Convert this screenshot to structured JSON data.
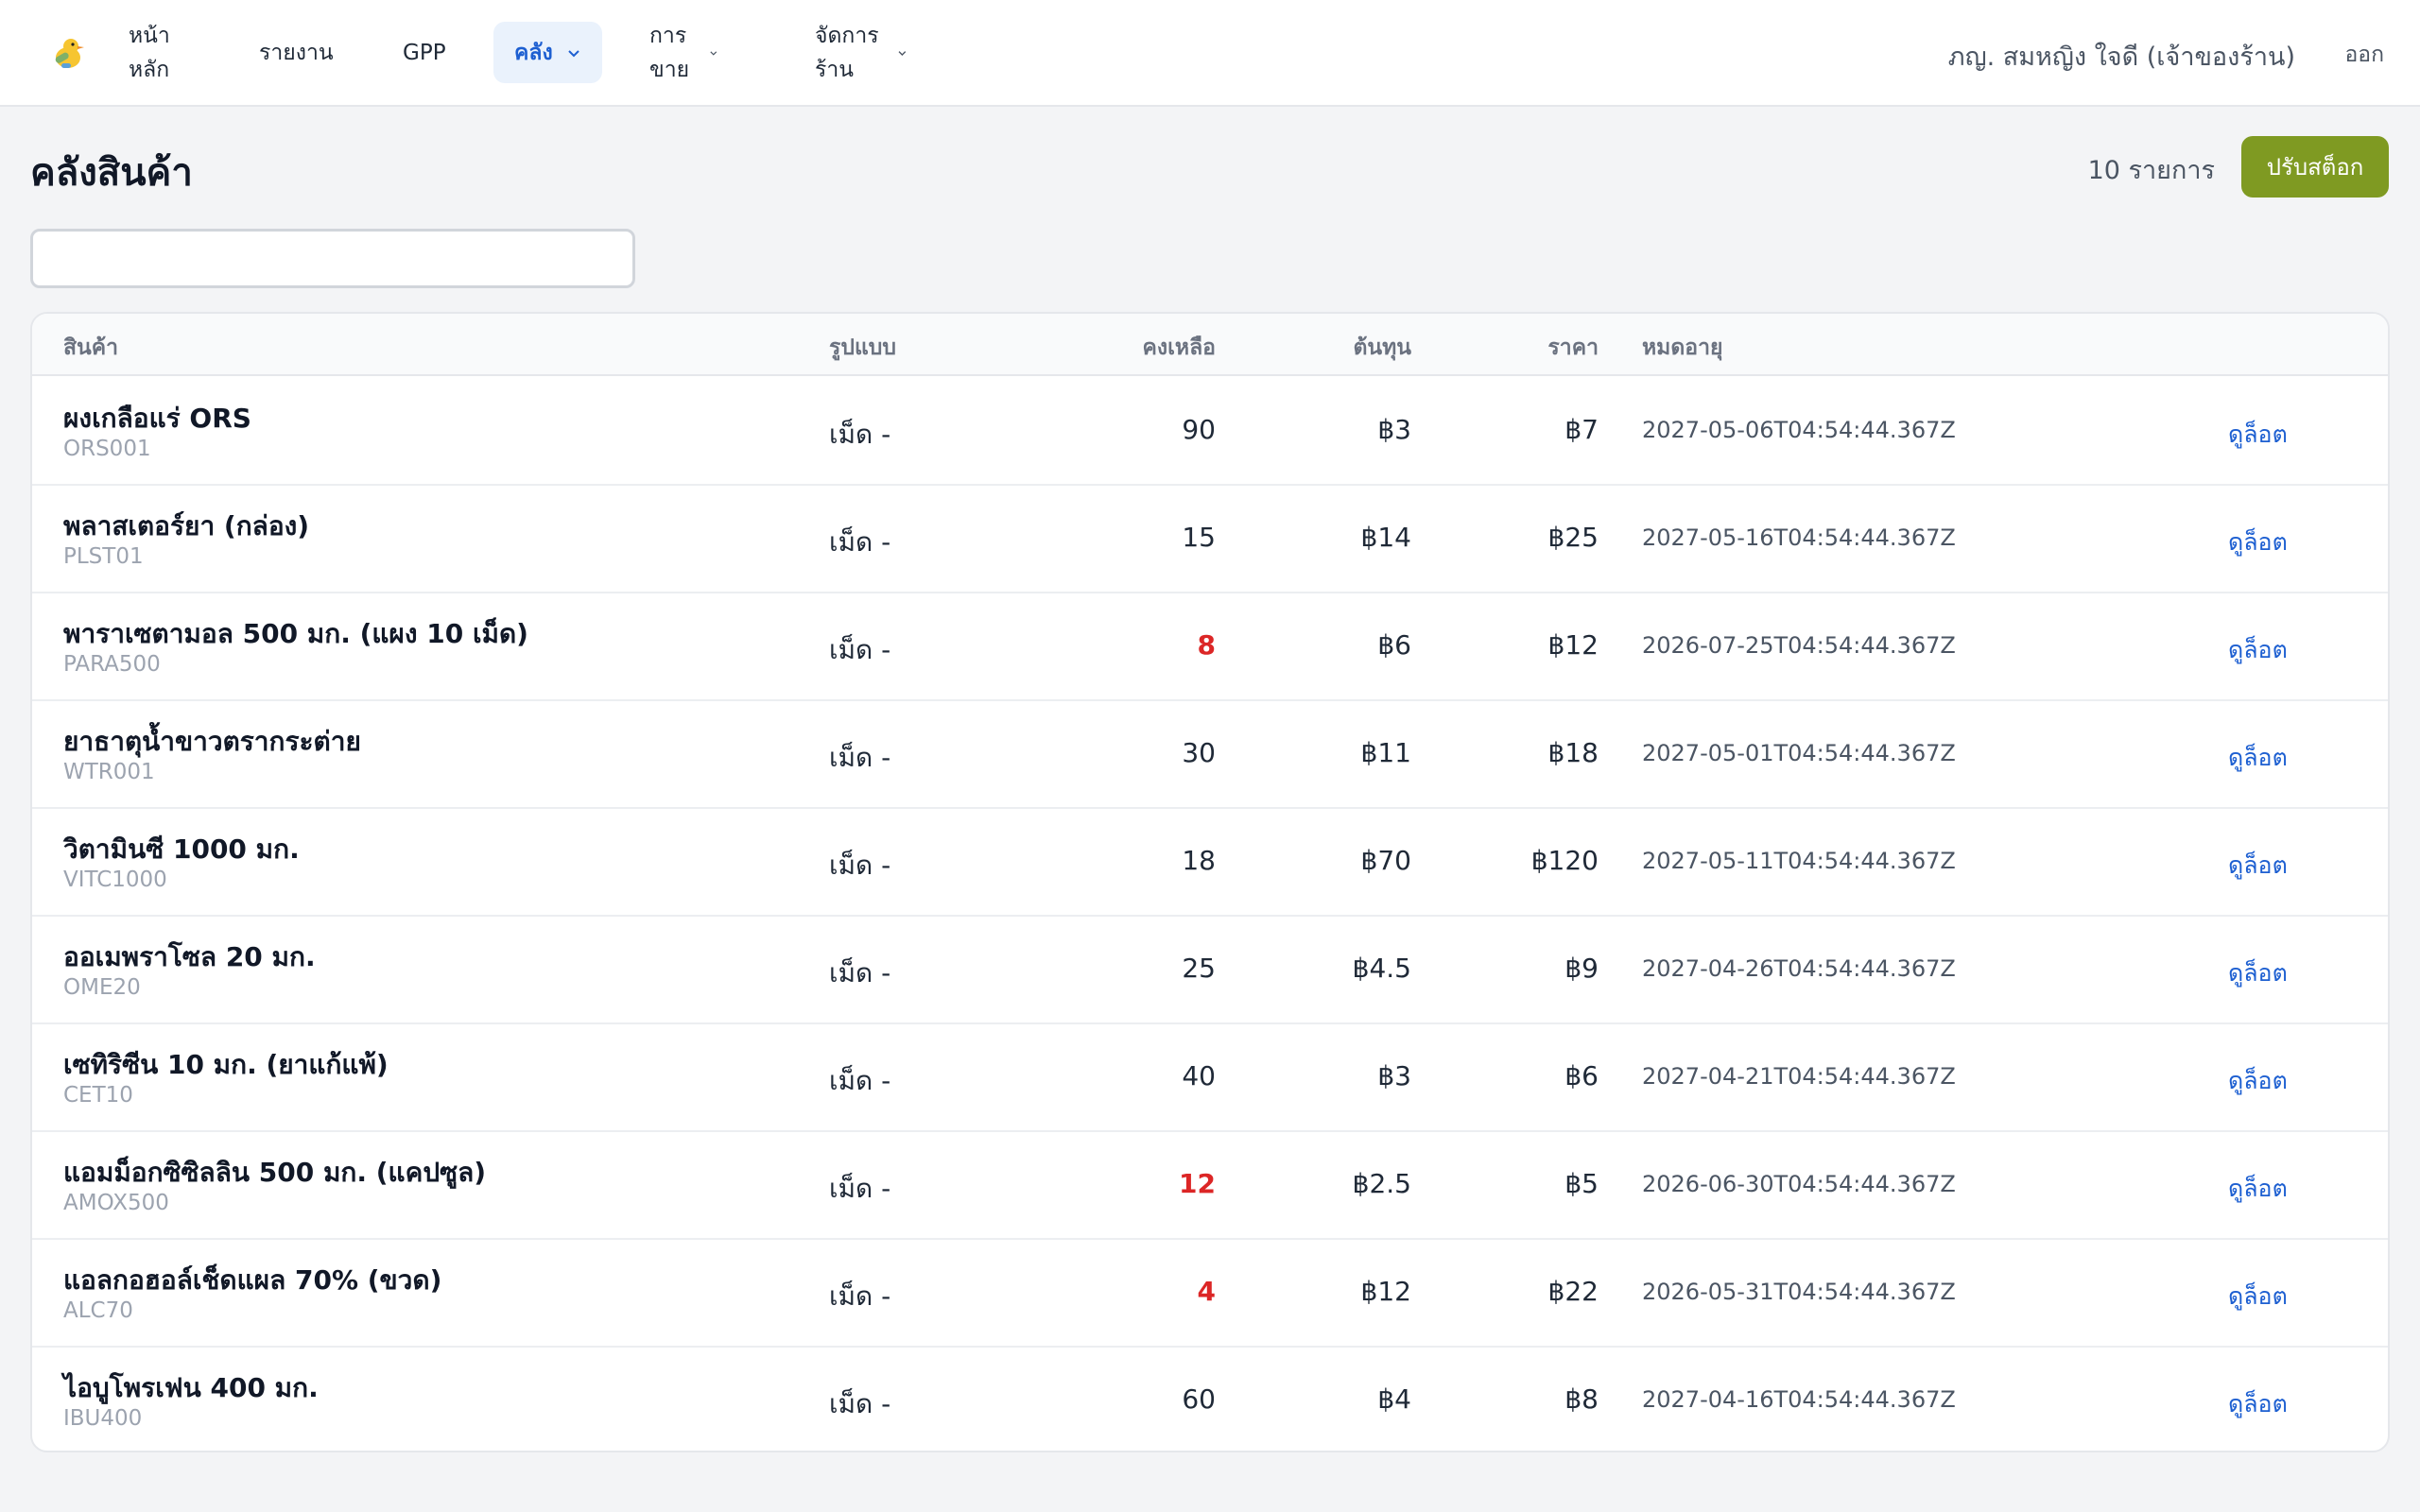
{
  "nav": {
    "logo_icon": "chick-pill-icon",
    "items": [
      {
        "label": "หน้าหลัก",
        "has_dropdown": false,
        "active": false
      },
      {
        "label": "รายงาน",
        "has_dropdown": false,
        "active": false
      },
      {
        "label": "GPP",
        "has_dropdown": false,
        "active": false
      },
      {
        "label": "คลัง",
        "has_dropdown": true,
        "active": true
      },
      {
        "label": "การขาย",
        "has_dropdown": true,
        "active": false
      },
      {
        "label": "จัดการร้าน",
        "has_dropdown": true,
        "active": false
      }
    ],
    "user": "ภญ. สมหญิง ใจดี (เจ้าของร้าน)",
    "logout": "ออก"
  },
  "page": {
    "title": "คลังสินค้า",
    "count": "10 รายการ",
    "adjust_label": "ปรับสต็อก",
    "search_value": "",
    "search_placeholder": ""
  },
  "table": {
    "headers": {
      "product": "สินค้า",
      "form": "รูปแบบ",
      "remaining": "คงเหลือ",
      "cost": "ต้นทุน",
      "price": "ราคา",
      "expiry": "หมดอายุ"
    },
    "rows": [
      {
        "name": "ผงเกลือแร่ ORS",
        "code": "ORS001",
        "form": "เม็ด -",
        "remaining": "90",
        "low": false,
        "cost": "฿3",
        "price": "฿7",
        "expiry": "2027-05-06T04:54:44.367Z",
        "action": "ดูล็อต"
      },
      {
        "name": "พลาสเตอร์ยา (กล่อง)",
        "code": "PLST01",
        "form": "เม็ด -",
        "remaining": "15",
        "low": false,
        "cost": "฿14",
        "price": "฿25",
        "expiry": "2027-05-16T04:54:44.367Z",
        "action": "ดูล็อต"
      },
      {
        "name": "พาราเซตามอล 500 มก. (แผง 10 เม็ด)",
        "code": "PARA500",
        "form": "เม็ด -",
        "remaining": "8",
        "low": true,
        "cost": "฿6",
        "price": "฿12",
        "expiry": "2026-07-25T04:54:44.367Z",
        "action": "ดูล็อต"
      },
      {
        "name": "ยาธาตุน้ำขาวตรากระต่าย",
        "code": "WTR001",
        "form": "เม็ด -",
        "remaining": "30",
        "low": false,
        "cost": "฿11",
        "price": "฿18",
        "expiry": "2027-05-01T04:54:44.367Z",
        "action": "ดูล็อต"
      },
      {
        "name": "วิตามินซี 1000 มก.",
        "code": "VITC1000",
        "form": "เม็ด -",
        "remaining": "18",
        "low": false,
        "cost": "฿70",
        "price": "฿120",
        "expiry": "2027-05-11T04:54:44.367Z",
        "action": "ดูล็อต"
      },
      {
        "name": "ออเมพราโซล 20 มก.",
        "code": "OME20",
        "form": "เม็ด -",
        "remaining": "25",
        "low": false,
        "cost": "฿4.5",
        "price": "฿9",
        "expiry": "2027-04-26T04:54:44.367Z",
        "action": "ดูล็อต"
      },
      {
        "name": "เซทิริซีน 10 มก. (ยาแก้แพ้)",
        "code": "CET10",
        "form": "เม็ด -",
        "remaining": "40",
        "low": false,
        "cost": "฿3",
        "price": "฿6",
        "expiry": "2027-04-21T04:54:44.367Z",
        "action": "ดูล็อต"
      },
      {
        "name": "แอมม็อกซิซิลลิน 500 มก. (แคปซูล)",
        "code": "AMOX500",
        "form": "เม็ด -",
        "remaining": "12",
        "low": true,
        "cost": "฿2.5",
        "price": "฿5",
        "expiry": "2026-06-30T04:54:44.367Z",
        "action": "ดูล็อต"
      },
      {
        "name": "แอลกอฮอล์เช็ดแผล 70% (ขวด)",
        "code": "ALC70",
        "form": "เม็ด -",
        "remaining": "4",
        "low": true,
        "cost": "฿12",
        "price": "฿22",
        "expiry": "2026-05-31T04:54:44.367Z",
        "action": "ดูล็อต"
      },
      {
        "name": "ไอบูโพรเฟน 400 มก.",
        "code": "IBU400",
        "form": "เม็ด -",
        "remaining": "60",
        "low": false,
        "cost": "฿4",
        "price": "฿8",
        "expiry": "2027-04-16T04:54:44.367Z",
        "action": "ดูล็อต"
      }
    ]
  },
  "colors": {
    "accent": "#1d5fd1",
    "active_nav_bg": "#eaf2fc",
    "adjust_button": "#7f9a22",
    "low_stock": "#dc2626"
  }
}
